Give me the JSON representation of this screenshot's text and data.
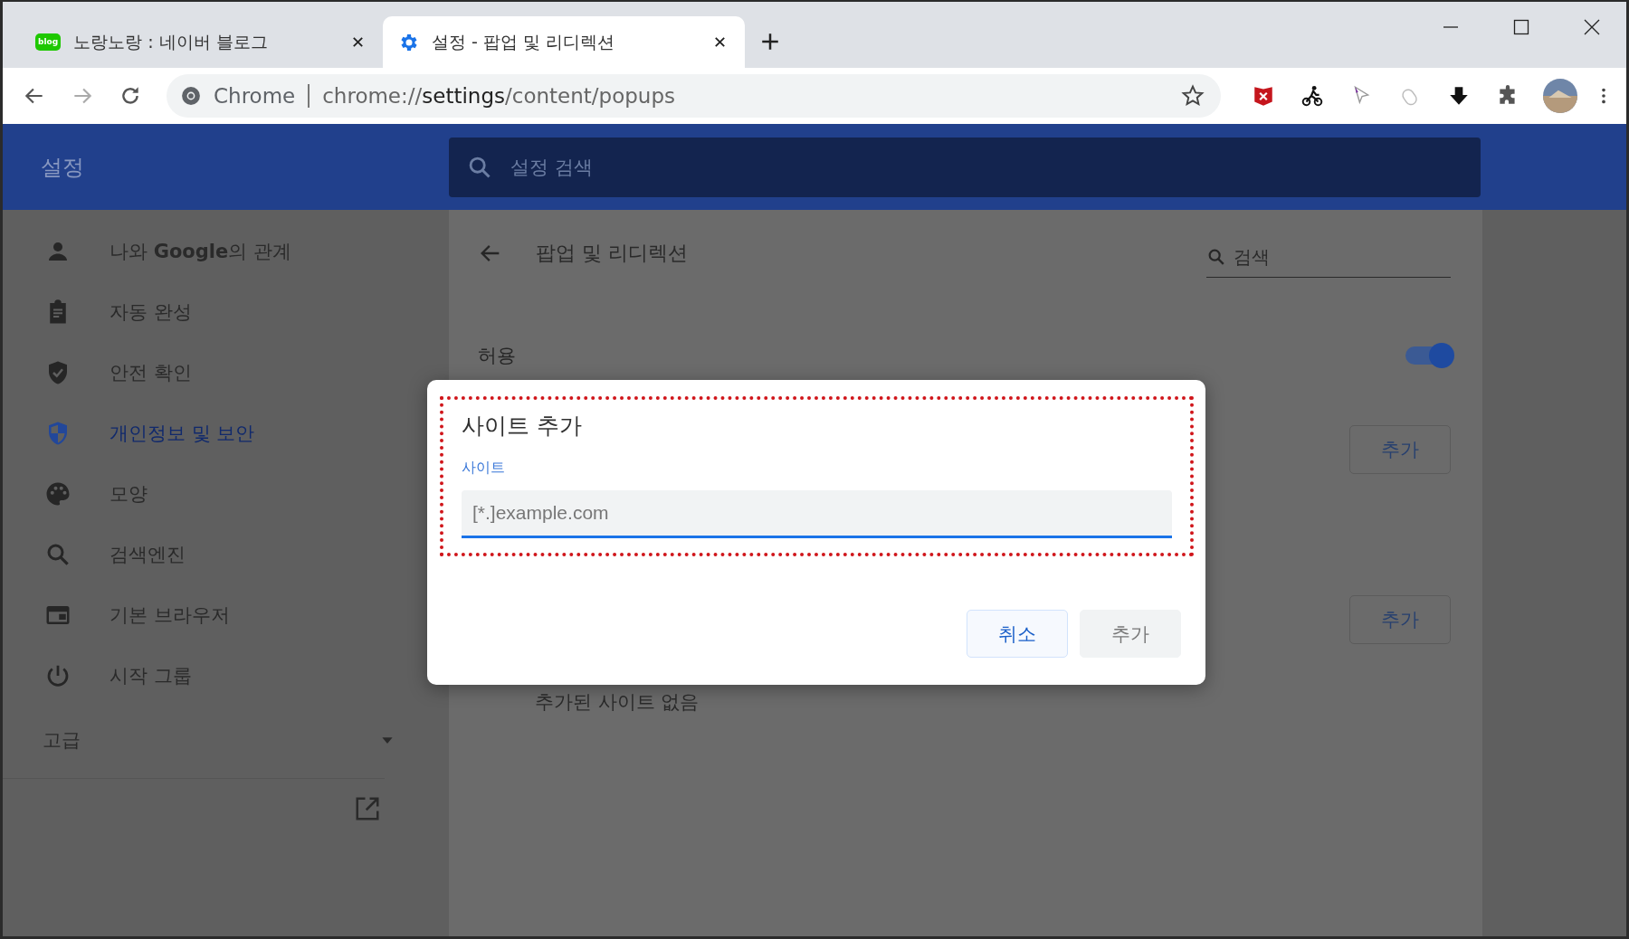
{
  "tabs": [
    {
      "title": "노랑노랑 : 네이버 블로그",
      "kind": "blog",
      "favicon_text": "blog",
      "selected": false
    },
    {
      "title": "설정 - 팝업 및 리디렉션",
      "kind": "gear",
      "selected": true
    }
  ],
  "address_bar": {
    "site_label": "Chrome",
    "url": "chrome://**settings**/content/popups"
  },
  "header": {
    "title": "설정",
    "search_placeholder": "설정 검색"
  },
  "sidebar": {
    "items": [
      {
        "label": "나와 **Google**의 관계",
        "kind": "person",
        "selected": false
      },
      {
        "label": "자동 완성",
        "kind": "clipboard",
        "selected": false
      },
      {
        "label": "안전 확인",
        "kind": "shield-check",
        "selected": false
      },
      {
        "label": "개인정보 및 보안",
        "kind": "shield",
        "selected": true
      },
      {
        "label": "모양",
        "kind": "palette",
        "selected": false
      },
      {
        "label": "검색엔진",
        "kind": "search",
        "selected": false
      },
      {
        "label": "기본 브라우저",
        "kind": "browser",
        "selected": false
      },
      {
        "label": "시작 그룹",
        "kind": "power",
        "selected": false
      }
    ],
    "advanced": {
      "label": "고급",
      "expanded": false
    }
  },
  "page": {
    "title": "팝업 및 리디렉션",
    "search_placeholder": "검색",
    "allow": {
      "label": "허용",
      "on": true
    },
    "add_buttons": [
      "추가",
      "추가"
    ],
    "empty_text": "추가된 사이트 없음"
  },
  "dialog": {
    "title": "사이트 추가",
    "field_label": "사이트",
    "placeholder": "[*.]example.com",
    "focused": true,
    "highlighted": true,
    "buttons": [
      {
        "label": "취소",
        "kind": "cancel",
        "disabled": false
      },
      {
        "label": "추가",
        "kind": "confirm",
        "disabled": true
      }
    ]
  }
}
